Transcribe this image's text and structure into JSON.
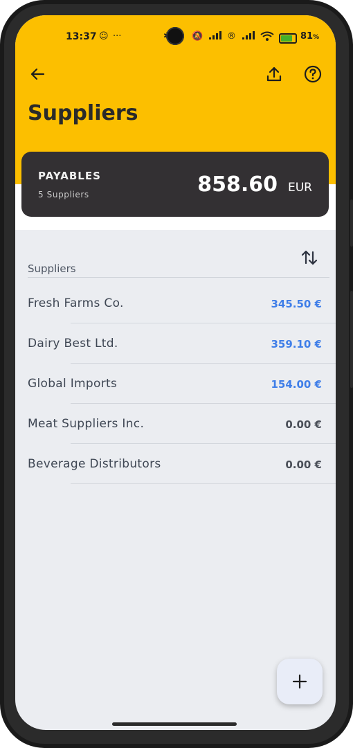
{
  "status_bar": {
    "time": "13:37",
    "battery_percent": "81",
    "battery_level": 0.81
  },
  "toolbar": {
    "back_icon": "arrow-back-icon",
    "share_icon": "upload-icon",
    "help_icon": "help-circle-icon"
  },
  "page": {
    "title": "Suppliers"
  },
  "summary_card": {
    "label": "PAYABLES",
    "subtitle": "5 Suppliers",
    "amount": "858.60",
    "currency": "EUR"
  },
  "list": {
    "section_title": "Suppliers",
    "sort_icon": "sort-arrows-icon",
    "items": [
      {
        "name": "Fresh Farms Co.",
        "amount": "345.50 €",
        "color": "#3f7ee8"
      },
      {
        "name": "Dairy Best Ltd.",
        "amount": "359.10 €",
        "color": "#3f7ee8"
      },
      {
        "name": "Global Imports",
        "amount": "154.00 €",
        "color": "#3f7ee8"
      },
      {
        "name": "Meat Suppliers Inc.",
        "amount": "0.00 €",
        "color": "#4a4f58"
      },
      {
        "name": "Beverage Distributors",
        "amount": "0.00 €",
        "color": "#4a4f58"
      }
    ]
  },
  "fab": {
    "icon": "plus-icon"
  },
  "colors": {
    "header": "#fcbf00",
    "card": "#333033",
    "positive_amount": "#3f7ee8"
  }
}
